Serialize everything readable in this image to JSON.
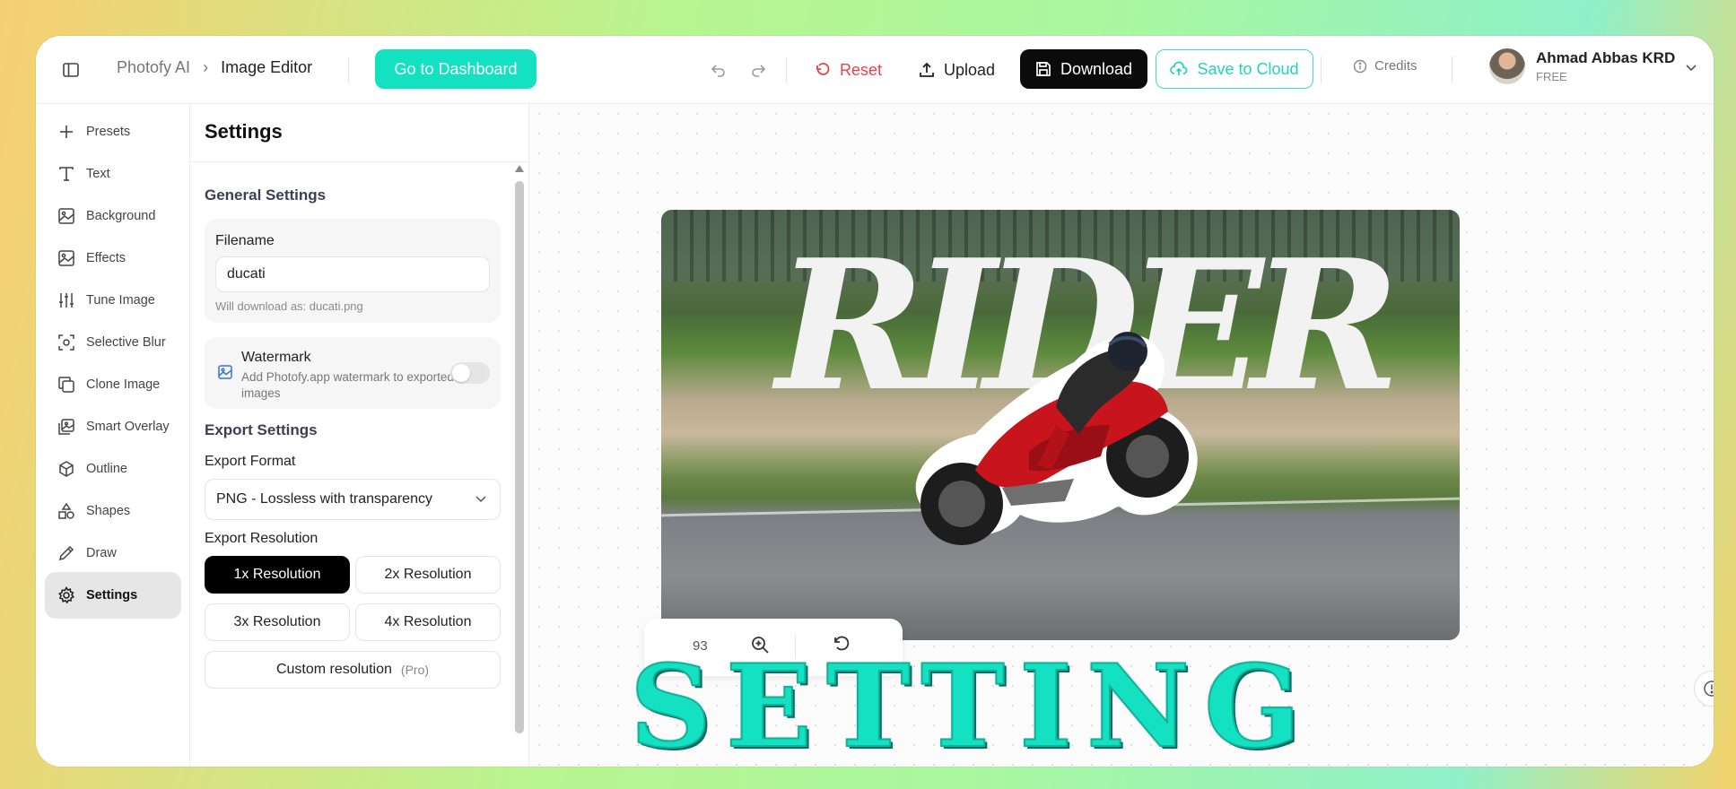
{
  "header": {
    "breadcrumb": [
      "Photofy AI",
      "Image Editor"
    ],
    "dashboard_label": "Go to Dashboard",
    "reset_label": "Reset",
    "upload_label": "Upload",
    "download_label": "Download",
    "save_label": "Save to Cloud",
    "credits_label": "Credits",
    "user_name": "Ahmad Abbas KRD",
    "user_plan": "FREE"
  },
  "nav": {
    "items": [
      {
        "label": "Presets",
        "icon": "plus-icon"
      },
      {
        "label": "Text",
        "icon": "text-icon"
      },
      {
        "label": "Background",
        "icon": "image-icon"
      },
      {
        "label": "Effects",
        "icon": "image-icon"
      },
      {
        "label": "Tune Image",
        "icon": "sliders-icon"
      },
      {
        "label": "Selective Blur",
        "icon": "focus-icon"
      },
      {
        "label": "Clone Image",
        "icon": "copy-icon"
      },
      {
        "label": "Smart Overlay",
        "icon": "image-stack-icon"
      },
      {
        "label": "Outline",
        "icon": "cube-icon"
      },
      {
        "label": "Shapes",
        "icon": "shapes-icon"
      },
      {
        "label": "Draw",
        "icon": "pencil-icon"
      },
      {
        "label": "Settings",
        "icon": "gear-icon"
      }
    ],
    "active": "Settings"
  },
  "panel": {
    "title": "Settings",
    "general_title": "General Settings",
    "filename_label": "Filename",
    "filename_value": "ducati",
    "filename_hint": "Will download as: ducati.png",
    "watermark_title": "Watermark",
    "watermark_desc": "Add Photofy.app watermark to exported images",
    "watermark_on": false,
    "export_title": "Export Settings",
    "format_label": "Export Format",
    "format_value": "PNG - Lossless with transparency",
    "resolution_label": "Export Resolution",
    "resolutions": [
      "1x Resolution",
      "2x Resolution",
      "3x Resolution",
      "4x Resolution"
    ],
    "active_resolution": "1x Resolution",
    "custom_label": "Custom resolution",
    "custom_badge": "(Pro)"
  },
  "canvas": {
    "image_text": "RIDER",
    "zoom_value": "93"
  },
  "overlay_title": "SETTING",
  "colors": {
    "accent": "#14e0c2",
    "reset": "#e8414a",
    "active_nav": "#e6e6e6"
  }
}
